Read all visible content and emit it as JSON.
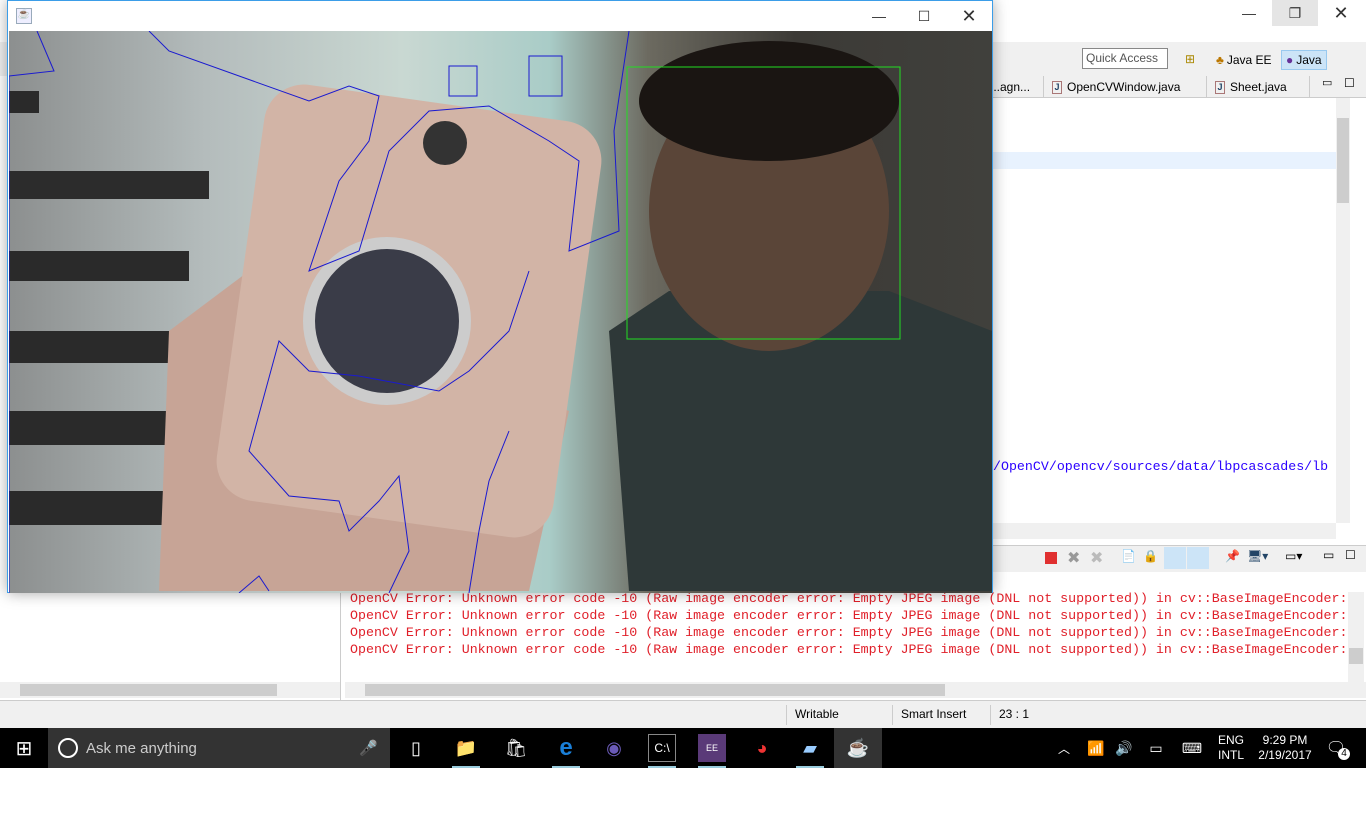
{
  "eclipse": {
    "quick_access": "Quick Access",
    "perspectives": [
      "Java EE",
      "Java"
    ],
    "editor_tabs": [
      "...agn...",
      "OpenCVWindow.java",
      "Sheet.java"
    ],
    "editor_visible_line": "a/OpenCV/opencv/sources/data/lbpcascades/lb",
    "console_lines": [
      "OpenCV Error: Unknown error code -10 (Raw image encoder error: Empty JPEG image (DNL not supported)) in cv::BaseImageEncoder:",
      "OpenCV Error: Unknown error code -10 (Raw image encoder error: Empty JPEG image (DNL not supported)) in cv::BaseImageEncoder:",
      "OpenCV Error: Unknown error code -10 (Raw image encoder error: Empty JPEG image (DNL not supported)) in cv::BaseImageEncoder:",
      "OpenCV Error: Unknown error code -10 (Raw image encoder error: Empty JPEG image (DNL not supported)) in cv::BaseImageEncoder:"
    ],
    "status": {
      "mode": "Writable",
      "insert": "Smart Insert",
      "position": "23 : 1"
    }
  },
  "taskbar": {
    "search_placeholder": "Ask me anything",
    "lang": "ENG",
    "lang_sub": "INTL",
    "time": "9:29 PM",
    "date": "2/19/2017",
    "notifications": "4"
  },
  "colors": {
    "console_error": "#e0202a",
    "face_box": "#22dd22",
    "contour": "#1a1ad0"
  }
}
